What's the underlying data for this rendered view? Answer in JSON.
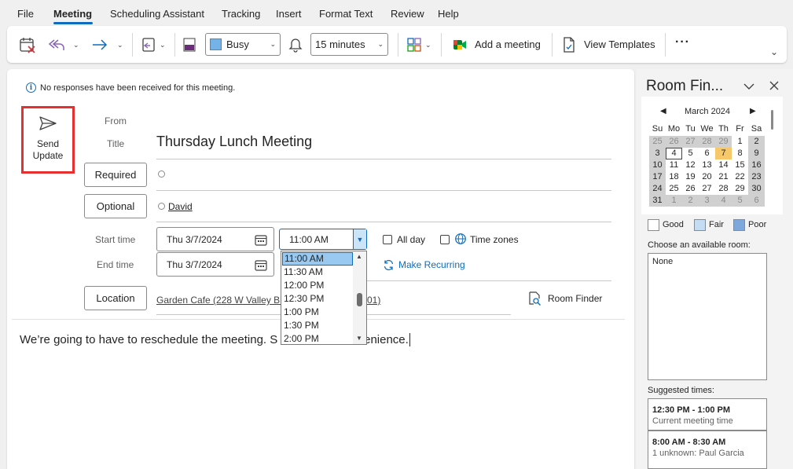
{
  "menu": {
    "tabs": [
      "File",
      "Meeting",
      "Scheduling Assistant",
      "Tracking",
      "Insert",
      "Format Text",
      "Review",
      "Help"
    ],
    "active": "Meeting"
  },
  "ribbon": {
    "show_as": "Busy",
    "reminder": "15 minutes",
    "add_meeting": "Add a meeting",
    "view_templates": "View Templates",
    "more": "···"
  },
  "info": "No responses have been received for this meeting.",
  "send_button": {
    "line1": "Send",
    "line2": "Update"
  },
  "form": {
    "from_label": "From",
    "title_label": "Title",
    "title_value": "Thursday Lunch Meeting",
    "required_label": "Required",
    "optional_label": "Optional",
    "optional_attendee": "David",
    "start_label": "Start time",
    "end_label": "End time",
    "start_date": "Thu 3/7/2024",
    "end_date": "Thu 3/7/2024",
    "start_time": "11:00 AM",
    "all_day": "All day",
    "time_zones": "Time zones",
    "make_recurring": "Make Recurring",
    "location_label": "Location",
    "location_value": "Garden Cafe (228 W Valley Blvd",
    "location_tail": "01)",
    "room_finder": "Room Finder"
  },
  "time_options": [
    "11:00 AM",
    "11:30 AM",
    "12:00 PM",
    "12:30 PM",
    "1:00 PM",
    "1:30 PM",
    "2:00 PM"
  ],
  "body": {
    "part1": "We’re going to have to reschedule the meeting. S",
    "part2": "nvenience."
  },
  "room_finder": {
    "title": "Room Fin...",
    "month": "March 2024",
    "weekdays": [
      "Su",
      "Mo",
      "Tu",
      "We",
      "Th",
      "Fr",
      "Sa"
    ],
    "weeks": [
      [
        "25",
        "26",
        "27",
        "28",
        "29",
        "1",
        "2"
      ],
      [
        "3",
        "4",
        "5",
        "6",
        "7",
        "8",
        "9"
      ],
      [
        "10",
        "11",
        "12",
        "13",
        "14",
        "15",
        "16"
      ],
      [
        "17",
        "18",
        "19",
        "20",
        "21",
        "22",
        "23"
      ],
      [
        "24",
        "25",
        "26",
        "27",
        "28",
        "29",
        "30"
      ],
      [
        "31",
        "1",
        "2",
        "3",
        "4",
        "5",
        "6"
      ]
    ],
    "legend": [
      "Good",
      "Fair",
      "Poor"
    ],
    "legend_colors": [
      "#ffffff",
      "#c5dcf5",
      "#7ea7dc"
    ],
    "choose_label": "Choose an available room:",
    "rooms": [
      "None"
    ],
    "suggested_label": "Suggested times:",
    "suggestions": [
      {
        "time": "12:30 PM - 1:00 PM",
        "note": "Current meeting time"
      },
      {
        "time": "8:00 AM - 8:30 AM",
        "note": "1 unknown: Paul Garcia"
      }
    ]
  },
  "colors": {
    "accent": "#0f6cbd",
    "highlight": "#e82f2f",
    "selected_day": "#f7c86a"
  }
}
